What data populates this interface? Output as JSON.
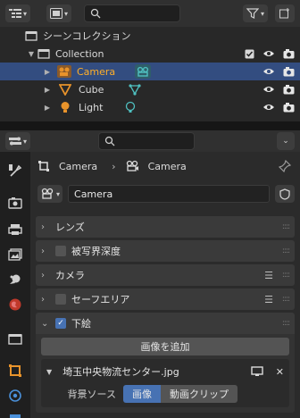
{
  "outliner": {
    "search": {
      "placeholder": ""
    },
    "rows": [
      {
        "label": "シーンコレクション"
      },
      {
        "label": "Collection"
      },
      {
        "label": "Camera"
      },
      {
        "label": "Cube"
      },
      {
        "label": "Light"
      }
    ]
  },
  "properties": {
    "breadcrumb": {
      "object": "Camera",
      "data": "Camera"
    },
    "datablock": {
      "name": "Camera"
    },
    "panels": {
      "lens": "レンズ",
      "dof": "被写界深度",
      "camera": "カメラ",
      "safe_areas": "セーフエリア",
      "background": "下絵"
    },
    "background_images": {
      "add_button": "画像を追加",
      "image_name": "埼玉中央物流センター.jpg",
      "source_label": "背景ソース",
      "source_options": [
        "画像",
        "動画クリップ"
      ],
      "source_selected": "画像"
    }
  },
  "colors": {
    "selection": "#334d80",
    "active_text": "#ffaf29",
    "camera_data": "#4fc0c0",
    "object_orange": "#e8932b",
    "accent_blue": "#4772b3"
  }
}
